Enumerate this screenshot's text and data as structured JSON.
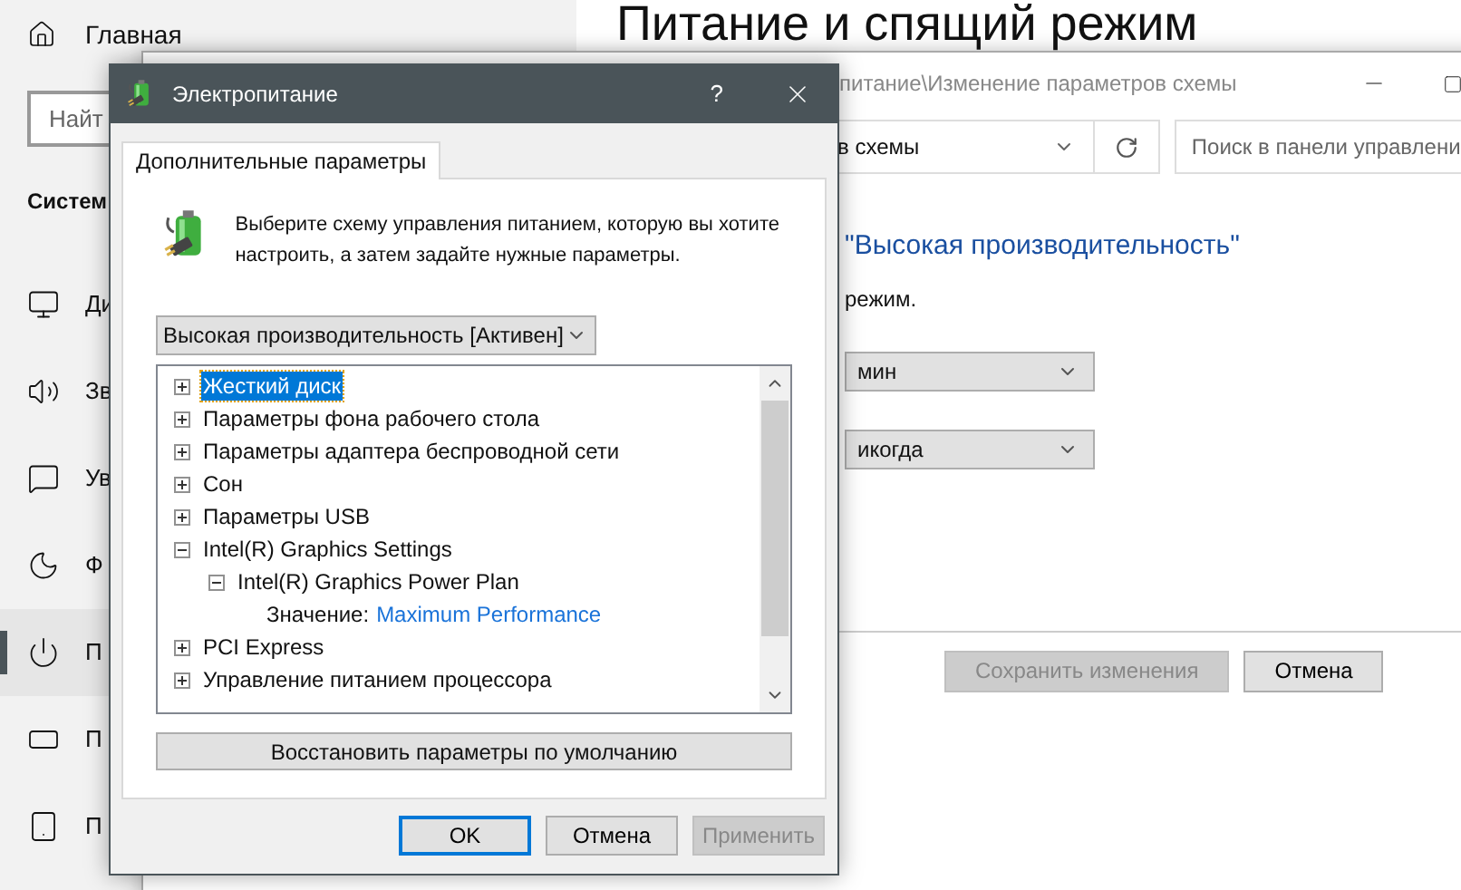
{
  "settings": {
    "home": "Главная",
    "search_placeholder": "Найт",
    "section": "Систем",
    "title": "Питание и спящий режим",
    "items": [
      {
        "label": "Ди",
        "kind": "display",
        "selected": false
      },
      {
        "label": "Зв",
        "kind": "sound",
        "selected": false
      },
      {
        "label": "Ув",
        "kind": "notifications",
        "selected": false
      },
      {
        "label": "Ф",
        "kind": "focus",
        "selected": false
      },
      {
        "label": "П",
        "kind": "power",
        "selected": true
      },
      {
        "label": "П",
        "kind": "storage",
        "selected": false
      },
      {
        "label": "П",
        "kind": "tablet",
        "selected": false
      }
    ]
  },
  "control_panel": {
    "title": "питание\\Изменение параметров схемы",
    "address": "в схемы",
    "search_placeholder": "Поиск в панели управлени",
    "heading": "\"Высокая производительность\"",
    "subtitle": "режим.",
    "dropdowns": [
      "мин",
      "икогда"
    ],
    "buttons": [
      {
        "label": "Сохранить изменения",
        "disabled": true
      },
      {
        "label": "Отмена",
        "disabled": false
      }
    ]
  },
  "dialog": {
    "title": "Электропитание",
    "help": "?",
    "tabs": [
      {
        "label": "Дополнительные параметры",
        "selected": true
      }
    ],
    "intro": "Выберите схему управления питанием, которую вы хотите настроить, а затем задайте нужные параметры.",
    "plan": "Высокая производительность [Активен]",
    "tree": [
      {
        "label": "Жесткий диск",
        "expanded": false,
        "selected": true
      },
      {
        "label": "Параметры фона рабочего стола",
        "expanded": false,
        "selected": false
      },
      {
        "label": "Параметры адаптера беспроводной сети",
        "expanded": false,
        "selected": false
      },
      {
        "label": "Сон",
        "expanded": false,
        "selected": false
      },
      {
        "label": "Параметры USB",
        "expanded": false,
        "selected": false
      },
      {
        "label": "Intel(R) Graphics Settings",
        "expanded": true,
        "selected": false,
        "children": [
          {
            "label": "Intel(R) Graphics Power Plan",
            "expanded": true,
            "selected": false,
            "children": [
              {
                "kind": "value",
                "label": "Значение:",
                "value": "Maximum Performance"
              }
            ]
          }
        ]
      },
      {
        "label": "PCI Express",
        "expanded": false,
        "selected": false
      },
      {
        "label": "Управление питанием процессора",
        "expanded": false,
        "selected": false
      }
    ],
    "restore": "Восстановить параметры по умолчанию",
    "buttons": [
      {
        "label": "OK",
        "default": true,
        "disabled": false
      },
      {
        "label": "Отмена",
        "default": false,
        "disabled": false
      },
      {
        "label": "Применить",
        "default": false,
        "disabled": true
      }
    ]
  }
}
